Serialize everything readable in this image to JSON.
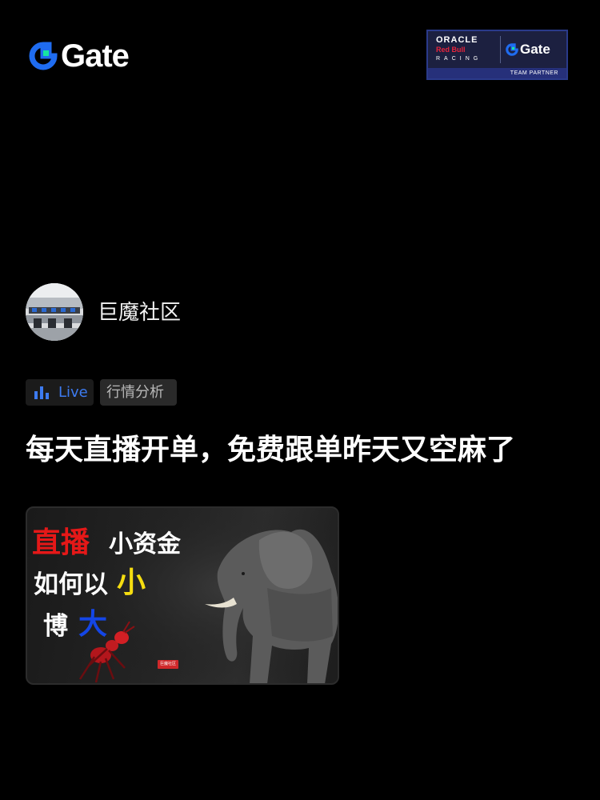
{
  "header": {
    "logo_text": "Gate",
    "logo_icon": "gate-logo-icon",
    "partner_badge": {
      "oracle": "ORACLE",
      "redbull": "Red Bull",
      "racing": "RACING",
      "brand": "Gate",
      "strip": "TEAM PARTNER"
    }
  },
  "author": {
    "name": "巨魔社区",
    "avatar_icon": "office-photo-avatar"
  },
  "tags": {
    "live_label": "Live",
    "live_icon": "bar-chart-icon",
    "category": "行情分析"
  },
  "post": {
    "title": "每天直播开单，免费跟单昨天又空麻了",
    "thumbnail": {
      "line1_a": "直播",
      "line1_b": "小资金",
      "line2_a": "如何以",
      "line2_b": "小",
      "line3_a": "博",
      "line3_b": "大",
      "stamp": "巨魔社区"
    }
  },
  "colors": {
    "background": "#000000",
    "accent_blue": "#3d7bf0",
    "gate_green": "#17e6a1",
    "gate_blue": "#1f6cf0"
  }
}
